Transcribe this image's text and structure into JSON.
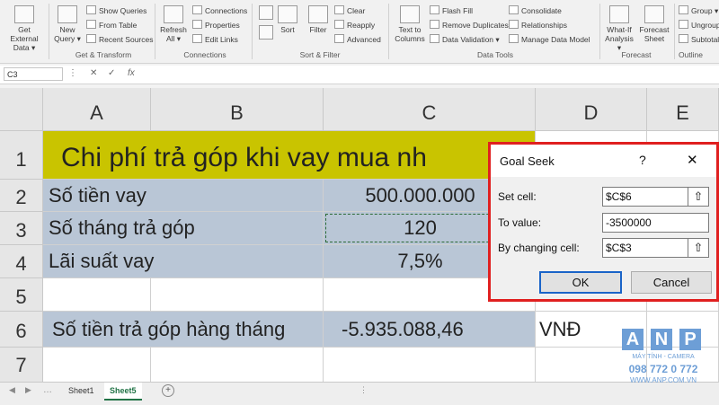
{
  "ribbon": {
    "groups": {
      "get_transform": "Get & Transform",
      "connections": "Connections",
      "sort_filter": "Sort & Filter",
      "data_tools": "Data Tools",
      "forecast": "Forecast",
      "outline": "Outline"
    },
    "get_external": [
      "Get External",
      "Data ▾"
    ],
    "new_query": [
      "New",
      "Query ▾"
    ],
    "show_queries": "Show Queries",
    "from_table": "From Table",
    "recent_sources": "Recent Sources",
    "refresh_all": [
      "Refresh",
      "All ▾"
    ],
    "connections": "Connections",
    "properties": "Properties",
    "edit_links": "Edit Links",
    "sort": "Sort",
    "filter": "Filter",
    "clear": "Clear",
    "reapply": "Reapply",
    "advanced": "Advanced",
    "text_to_columns": [
      "Text to",
      "Columns"
    ],
    "flash_fill": "Flash Fill",
    "remove_duplicates": "Remove Duplicates",
    "data_validation": "Data Validation ▾",
    "consolidate": "Consolidate",
    "relationships": "Relationships",
    "manage_data_model": "Manage Data Model",
    "what_if": [
      "What-If",
      "Analysis ▾"
    ],
    "forecast_sheet": [
      "Forecast",
      "Sheet"
    ],
    "group": "Group ▾",
    "ungroup": "Ungroup ▾",
    "subtotal": "Subtotal"
  },
  "formula_bar": {
    "name_box": "C3",
    "fx": "fx"
  },
  "columns": [
    "A",
    "B",
    "C",
    "D",
    "E"
  ],
  "rows": [
    "1",
    "2",
    "3",
    "4",
    "5",
    "6",
    "7"
  ],
  "cells": {
    "title": "Chi phí trả góp khi vay mua nh",
    "a2": "Số tiền vay",
    "c2": "500.000.000",
    "a3": "Số tháng trả góp",
    "c3": "120",
    "a4": "Lãi suất vay",
    "c4": "7,5%",
    "a6": "Số tiền trả góp hàng tháng",
    "c6": "-5.935.088,46",
    "d6": "VNĐ"
  },
  "sheets": [
    "Sheet1",
    "Sheet5"
  ],
  "dialog": {
    "title": "Goal Seek",
    "help": "?",
    "close": "✕",
    "set_cell_label": "Set cell:",
    "set_cell_value": "$C$6",
    "to_value_label": "To value:",
    "to_value_value": "-3500000",
    "changing_cell_label": "By changing cell:",
    "changing_cell_value": "$C$3",
    "ok": "OK",
    "cancel": "Cancel"
  },
  "watermark": {
    "letters": [
      "A",
      "N",
      "P"
    ],
    "line1": "MÁY TÍNH - CAMERA",
    "phone": "098 772 0 772",
    "site": "WWW.ANP.COM.VN"
  }
}
